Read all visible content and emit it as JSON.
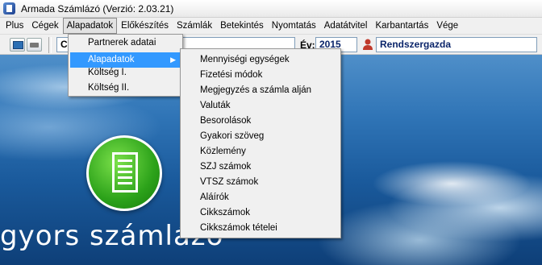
{
  "window": {
    "title": "Armada Számlázó (Verzió: 2.03.21)"
  },
  "menubar": [
    "Plus",
    "Cégek",
    "Alapadatok",
    "Előkészítés",
    "Számlák",
    "Betekintés",
    "Nyomtatás",
    "Adatátvitel",
    "Karbantartás",
    "Vége"
  ],
  "toolbar": {
    "company_value": "C",
    "year_label": "Év:",
    "year_value": "2015",
    "user_value": "Rendszergazda"
  },
  "dropdown": {
    "items": [
      "Partnerek adatai",
      "Alapadatok",
      "Költség I.",
      "Költség II."
    ],
    "selected": "Alapadatok"
  },
  "submenu": {
    "items": [
      "Mennyiségi egységek",
      "Fizetési módok",
      "Megjegyzés a számla alján",
      "Valuták",
      "Besorolások",
      "Gyakori szöveg",
      "Közlemény",
      "SZJ számok",
      "VTSZ számok",
      "Aláírók",
      "Cikkszámok",
      "Cikkszámok tételei"
    ]
  },
  "branding": {
    "text": "gyors számlázó"
  }
}
